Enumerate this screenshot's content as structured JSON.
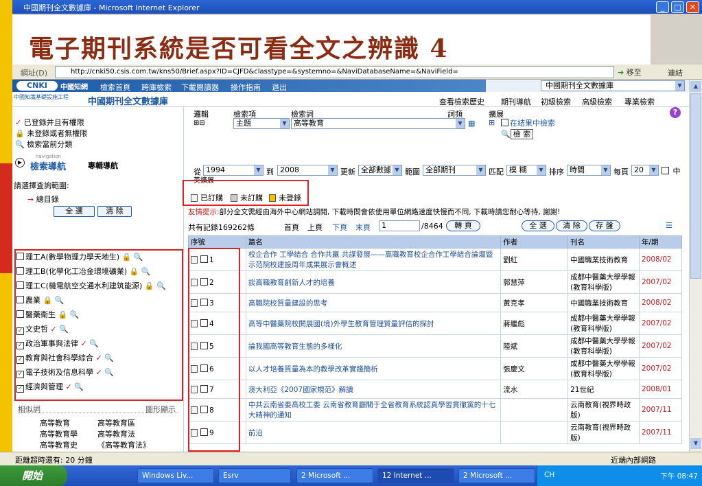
{
  "window": {
    "title": "中國期刊全文數據庫 - Microsoft Internet Explorer"
  },
  "slide_title": "電子期刊系統是否可看全文之辨識 4",
  "address": {
    "label": "網址(D)",
    "url": "http://cnki50.csis.com.tw/kns50/Brief.aspx?ID=CJFD&classtype=&systemno=&NaviDatabaseName=&NaviField=",
    "go_label": "移至",
    "links_label": "連結"
  },
  "site_nav": {
    "logo": "CNKI",
    "logo2": "中國知網",
    "items": [
      "檢索首頁",
      "跨庫檢索",
      "下載閱讀器",
      "操作指南",
      "退出"
    ],
    "db_select": "中國期刊全文數據庫"
  },
  "site_sub": {
    "small": "中國知識基礎設施工程",
    "big": "中國期刊全文數據庫"
  },
  "tabs": [
    "查看檢索歷史",
    "期刊導航",
    "初級檢索",
    "高級檢索",
    "專業檢索"
  ],
  "left": {
    "legend": [
      "已登錄并且有權限",
      "未登錄或者無權限",
      "檢索當前分類"
    ],
    "nav_small": "navigation",
    "nav_title": "檢索導航",
    "nav_sub": "專輯導航",
    "range_label": "請選擇查詢範圍:",
    "root_label": "總目錄",
    "btn_all": "全 選",
    "btn_clear": "清 除",
    "categories": [
      {
        "label": "理工A(數學物理力學天地生)",
        "checked": false,
        "marker": "lock"
      },
      {
        "label": "理工B(化學化工冶金環境礦業)",
        "checked": false,
        "marker": "lock"
      },
      {
        "label": "理工C(機電航空交通水利建筑能源)",
        "checked": false,
        "marker": "lock"
      },
      {
        "label": "農業",
        "checked": false,
        "marker": "lock"
      },
      {
        "label": "醫藥衛生",
        "checked": false,
        "marker": "lock"
      },
      {
        "label": "文史哲",
        "checked": true,
        "marker": "check"
      },
      {
        "label": "政治軍事與法律",
        "checked": true,
        "marker": "check"
      },
      {
        "label": "教育與社會科學綜合",
        "checked": true,
        "marker": "check"
      },
      {
        "label": "電子技術及信息科學",
        "checked": true,
        "marker": "check"
      },
      {
        "label": "經濟與管理",
        "checked": true,
        "marker": "check"
      }
    ],
    "related_label": "相似詞",
    "graph_label": "圖形顯示",
    "related_terms": [
      [
        "高等教育",
        "高等教育區"
      ],
      [
        "高等教育學",
        "高等教育法"
      ],
      [
        "高等教育史",
        "《高等教育法》"
      ]
    ]
  },
  "search": {
    "logic_label": "邏輯",
    "field_label": "檢索項",
    "term_label": "檢索詞",
    "freq_label": "詞頻",
    "expand_label": "擴展",
    "field_value": "主題",
    "term_value": "高等教育",
    "in_results": "在結果中檢索",
    "search_btn": "檢 索",
    "from_label": "從",
    "from_year": "1994",
    "to_label": "到",
    "to_year": "2008",
    "update_label": "更新",
    "update_value": "全部數據",
    "range_label": "範圍",
    "range_value": "全部期刊",
    "match_label": "匹配",
    "match_value": "模 糊",
    "sort_label": "排序",
    "sort_value": "時間",
    "perpage_label": "每頁",
    "perpage_value": "20",
    "lang_label": "中",
    "lang_label2": "英擴展"
  },
  "status_legend": [
    "已訂購",
    "未訂購",
    "未登錄"
  ],
  "notice": {
    "prefix": "友情提示:",
    "text": "部分全文需經由海外中心網站調閱, 下載時間會依使用單位網路速度快慢而不同, 下載時請您耐心等待, 謝謝!"
  },
  "results": {
    "total": "共有記錄169262條",
    "first": "首頁",
    "prev": "上頁",
    "next": "下頁",
    "last": "末頁",
    "page": "1",
    "pages": "/8464",
    "goto": "轉 頁",
    "select_all": "全 選",
    "clear": "清 除",
    "save": "存 盤"
  },
  "table": {
    "headers": [
      "序號",
      "篇名",
      "作者",
      "刊名",
      "年/期"
    ],
    "rows": [
      {
        "no": "1",
        "title": "校企合作 工學結合 合作共贏 共謀發展——高職教育校企合作工學結合論壇暨示范院校建設周年成果展示會概述",
        "author": "劉紅",
        "journal": "中國職業技術教育",
        "year": "2008/02"
      },
      {
        "no": "2",
        "title": "談高職教育創新人才的培養",
        "author": "郭慧萍",
        "journal": "成都中醫藥大學學報(教育科學版)",
        "year": "2007/02"
      },
      {
        "no": "3",
        "title": "高職院校質量建設的思考",
        "author": "黃克孝",
        "journal": "中國職業技術教育",
        "year": "2008/02"
      },
      {
        "no": "4",
        "title": "高等中醫藥院校開展國(境)外學生教育管理質量評估的探討",
        "author": "蔣繼彪",
        "journal": "成都中醫藥大學學報(教育科學版)",
        "year": "2007/02"
      },
      {
        "no": "5",
        "title": "論我國高等教育生態的多樣化",
        "author": "陸斌",
        "journal": "成都中醫藥大學學報(教育科學版)",
        "year": "2007/02"
      },
      {
        "no": "6",
        "title": "以人才培養質量為本的教學改革實踐簡析",
        "author": "張慶文",
        "journal": "成都中醫藥大學學報(教育科學版)",
        "year": "2007/02"
      },
      {
        "no": "7",
        "title": "澳大利亞《2007國家規范》解讀",
        "author": "流水",
        "journal": "21世紀",
        "year": "2008/01"
      },
      {
        "no": "8",
        "title": "中共云南省委高校工委 云南省教育廳關于全省教育系統認真學習貫徹黨的十七大精神的通知",
        "author": "",
        "journal": "云南教育(視界時政版)",
        "year": "2007/11"
      },
      {
        "no": "9",
        "title": "前沿",
        "author": "",
        "journal": "云南教育(視界時政版)",
        "year": "2007/11"
      }
    ]
  },
  "statusbar": {
    "left": "距離超時還有: 20 分鐘",
    "right": "近端內部網路"
  },
  "taskbar": {
    "start": "開始",
    "tasks": [
      "Windows Liv...",
      "Esrv",
      "2 Microsoft ...",
      "12 Internet ...",
      "2 Microsoft ..."
    ],
    "lang": "CH",
    "clock": "下午 08:47"
  },
  "colors": {
    "accent": "#1d5aa6",
    "highlight_box": "#e02020",
    "title_red": "#8b2b12"
  }
}
